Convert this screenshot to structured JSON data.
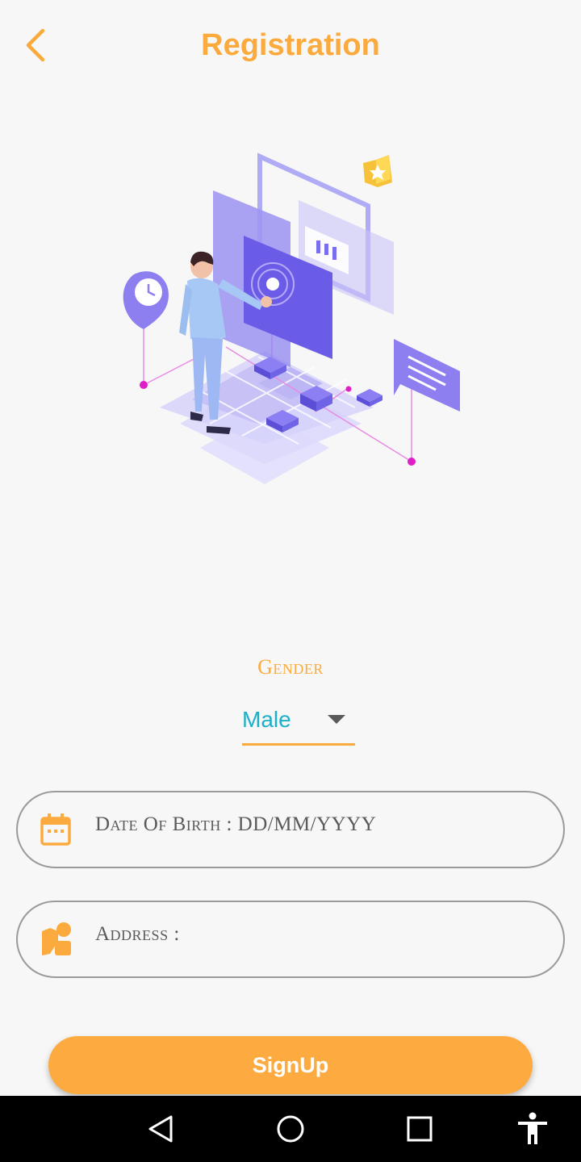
{
  "header": {
    "title": "Registration",
    "back_icon": "chevron-left-icon"
  },
  "gender": {
    "label": "Gender",
    "selected": "Male",
    "dropdown_icon": "triangle-down-icon"
  },
  "form": {
    "dob_placeholder": "Date Of Birth : DD/MM/YYYY",
    "dob_icon": "calendar-icon",
    "address_placeholder": "Address :",
    "address_icon": "address-icon"
  },
  "signup": {
    "label": "SignUp"
  },
  "navbar": {
    "icons": [
      "back-triangle-icon",
      "home-circle-icon",
      "recents-square-icon",
      "accessibility-icon"
    ]
  },
  "colors": {
    "accent": "#fbaa3e",
    "button": "#fdab40",
    "selected_text": "#1cb0c8",
    "field_border": "#9a9a9a",
    "background": "#f7f7f7"
  }
}
